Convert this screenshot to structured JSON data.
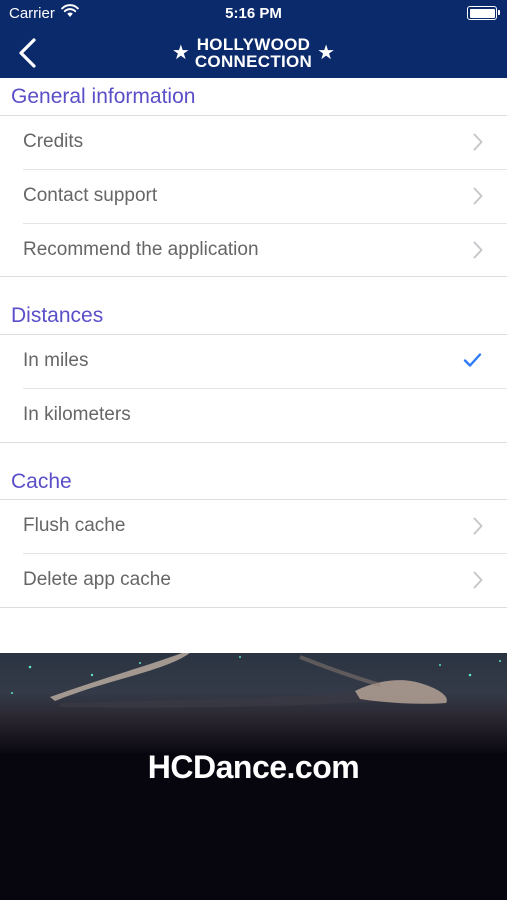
{
  "status_bar": {
    "carrier": "Carrier",
    "time": "5:16 PM",
    "battery_level": 1.0
  },
  "nav": {
    "logo_line1": "HOLLYWOOD",
    "logo_line2": "CONNECTION",
    "logo_star": "★"
  },
  "sections": {
    "general": {
      "title": "General information",
      "items": [
        {
          "label": "Credits",
          "accessory": "chevron-right-icon"
        },
        {
          "label": "Contact support",
          "accessory": "chevron-right-icon"
        },
        {
          "label": "Recommend the application",
          "accessory": "chevron-right-icon"
        }
      ]
    },
    "distances": {
      "title": "Distances",
      "items": [
        {
          "label": "In miles",
          "selected": true,
          "accessory": "checkmark-icon"
        },
        {
          "label": "In kilometers",
          "selected": false
        }
      ]
    },
    "cache": {
      "title": "Cache",
      "items": [
        {
          "label": "Flush cache",
          "accessory": "chevron-right-icon"
        },
        {
          "label": "Delete app cache",
          "accessory": "chevron-right-icon"
        }
      ]
    }
  },
  "banner": {
    "site": "HCDance.com"
  },
  "colors": {
    "nav_background": "#0b2a6b",
    "section_header": "#5a4fc8",
    "row_text": "#666666",
    "check": "#2f7bf5",
    "chevron": "#c7c7cc"
  }
}
